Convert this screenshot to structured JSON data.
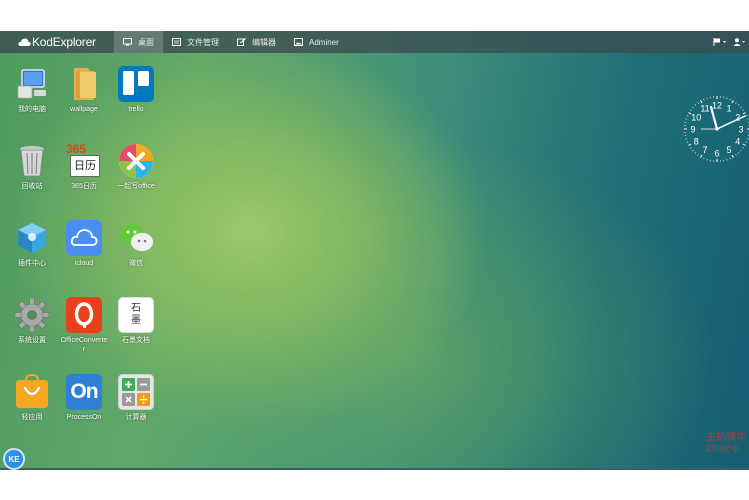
{
  "app": {
    "brand": "KodExplorer"
  },
  "nav": [
    {
      "label": "桌面",
      "icon": "desktop-icon"
    },
    {
      "label": "文件管理",
      "icon": "folder-list-icon"
    },
    {
      "label": "编辑器",
      "icon": "edit-icon"
    },
    {
      "label": "Adminer",
      "icon": "image-icon"
    }
  ],
  "topbar_right": {
    "flag_icon": "flag-icon",
    "user_icon": "user-icon"
  },
  "desktop_icons": [
    {
      "label": "我的电脑",
      "icon": "computer-icon"
    },
    {
      "label": "wallpage",
      "icon": "folder-icon"
    },
    {
      "label": "trello",
      "icon": "trello-icon"
    },
    {
      "label": "回收站",
      "icon": "recycle-bin-icon"
    },
    {
      "label": "365日历",
      "icon": "calendar-icon"
    },
    {
      "label": "一起写office",
      "icon": "office-icon"
    },
    {
      "label": "插件中心",
      "icon": "plugin-icon"
    },
    {
      "label": "icloud",
      "icon": "icloud-icon"
    },
    {
      "label": "微信",
      "icon": "wechat-icon"
    },
    {
      "label": "系统设置",
      "icon": "gear-icon"
    },
    {
      "label": "OfficeConverter",
      "icon": "officeconverter-icon"
    },
    {
      "label": "石墨文档",
      "icon": "shimo-icon"
    },
    {
      "label": "轻应用",
      "icon": "light-app-icon"
    },
    {
      "label": "ProcessOn",
      "icon": "processon-icon"
    },
    {
      "label": "计算器",
      "icon": "calculator-icon"
    }
  ],
  "calendar_icon_text": {
    "num": "365",
    "day": "日历"
  },
  "shimo_icon_text": "石墨",
  "processon_icon_text": "On",
  "clock": {
    "numbers": [
      "12",
      "1",
      "2",
      "3",
      "4",
      "5",
      "6",
      "7",
      "8",
      "9",
      "10",
      "11"
    ]
  },
  "start_button": "KE",
  "watermark": {
    "line1": "主机城华",
    "line2": "zhujibiji"
  },
  "colors": {
    "topbar": "#3c4b50",
    "accent": "#2f8fe0",
    "trello": "#0079bf",
    "officeconverter": "#e8401c"
  }
}
